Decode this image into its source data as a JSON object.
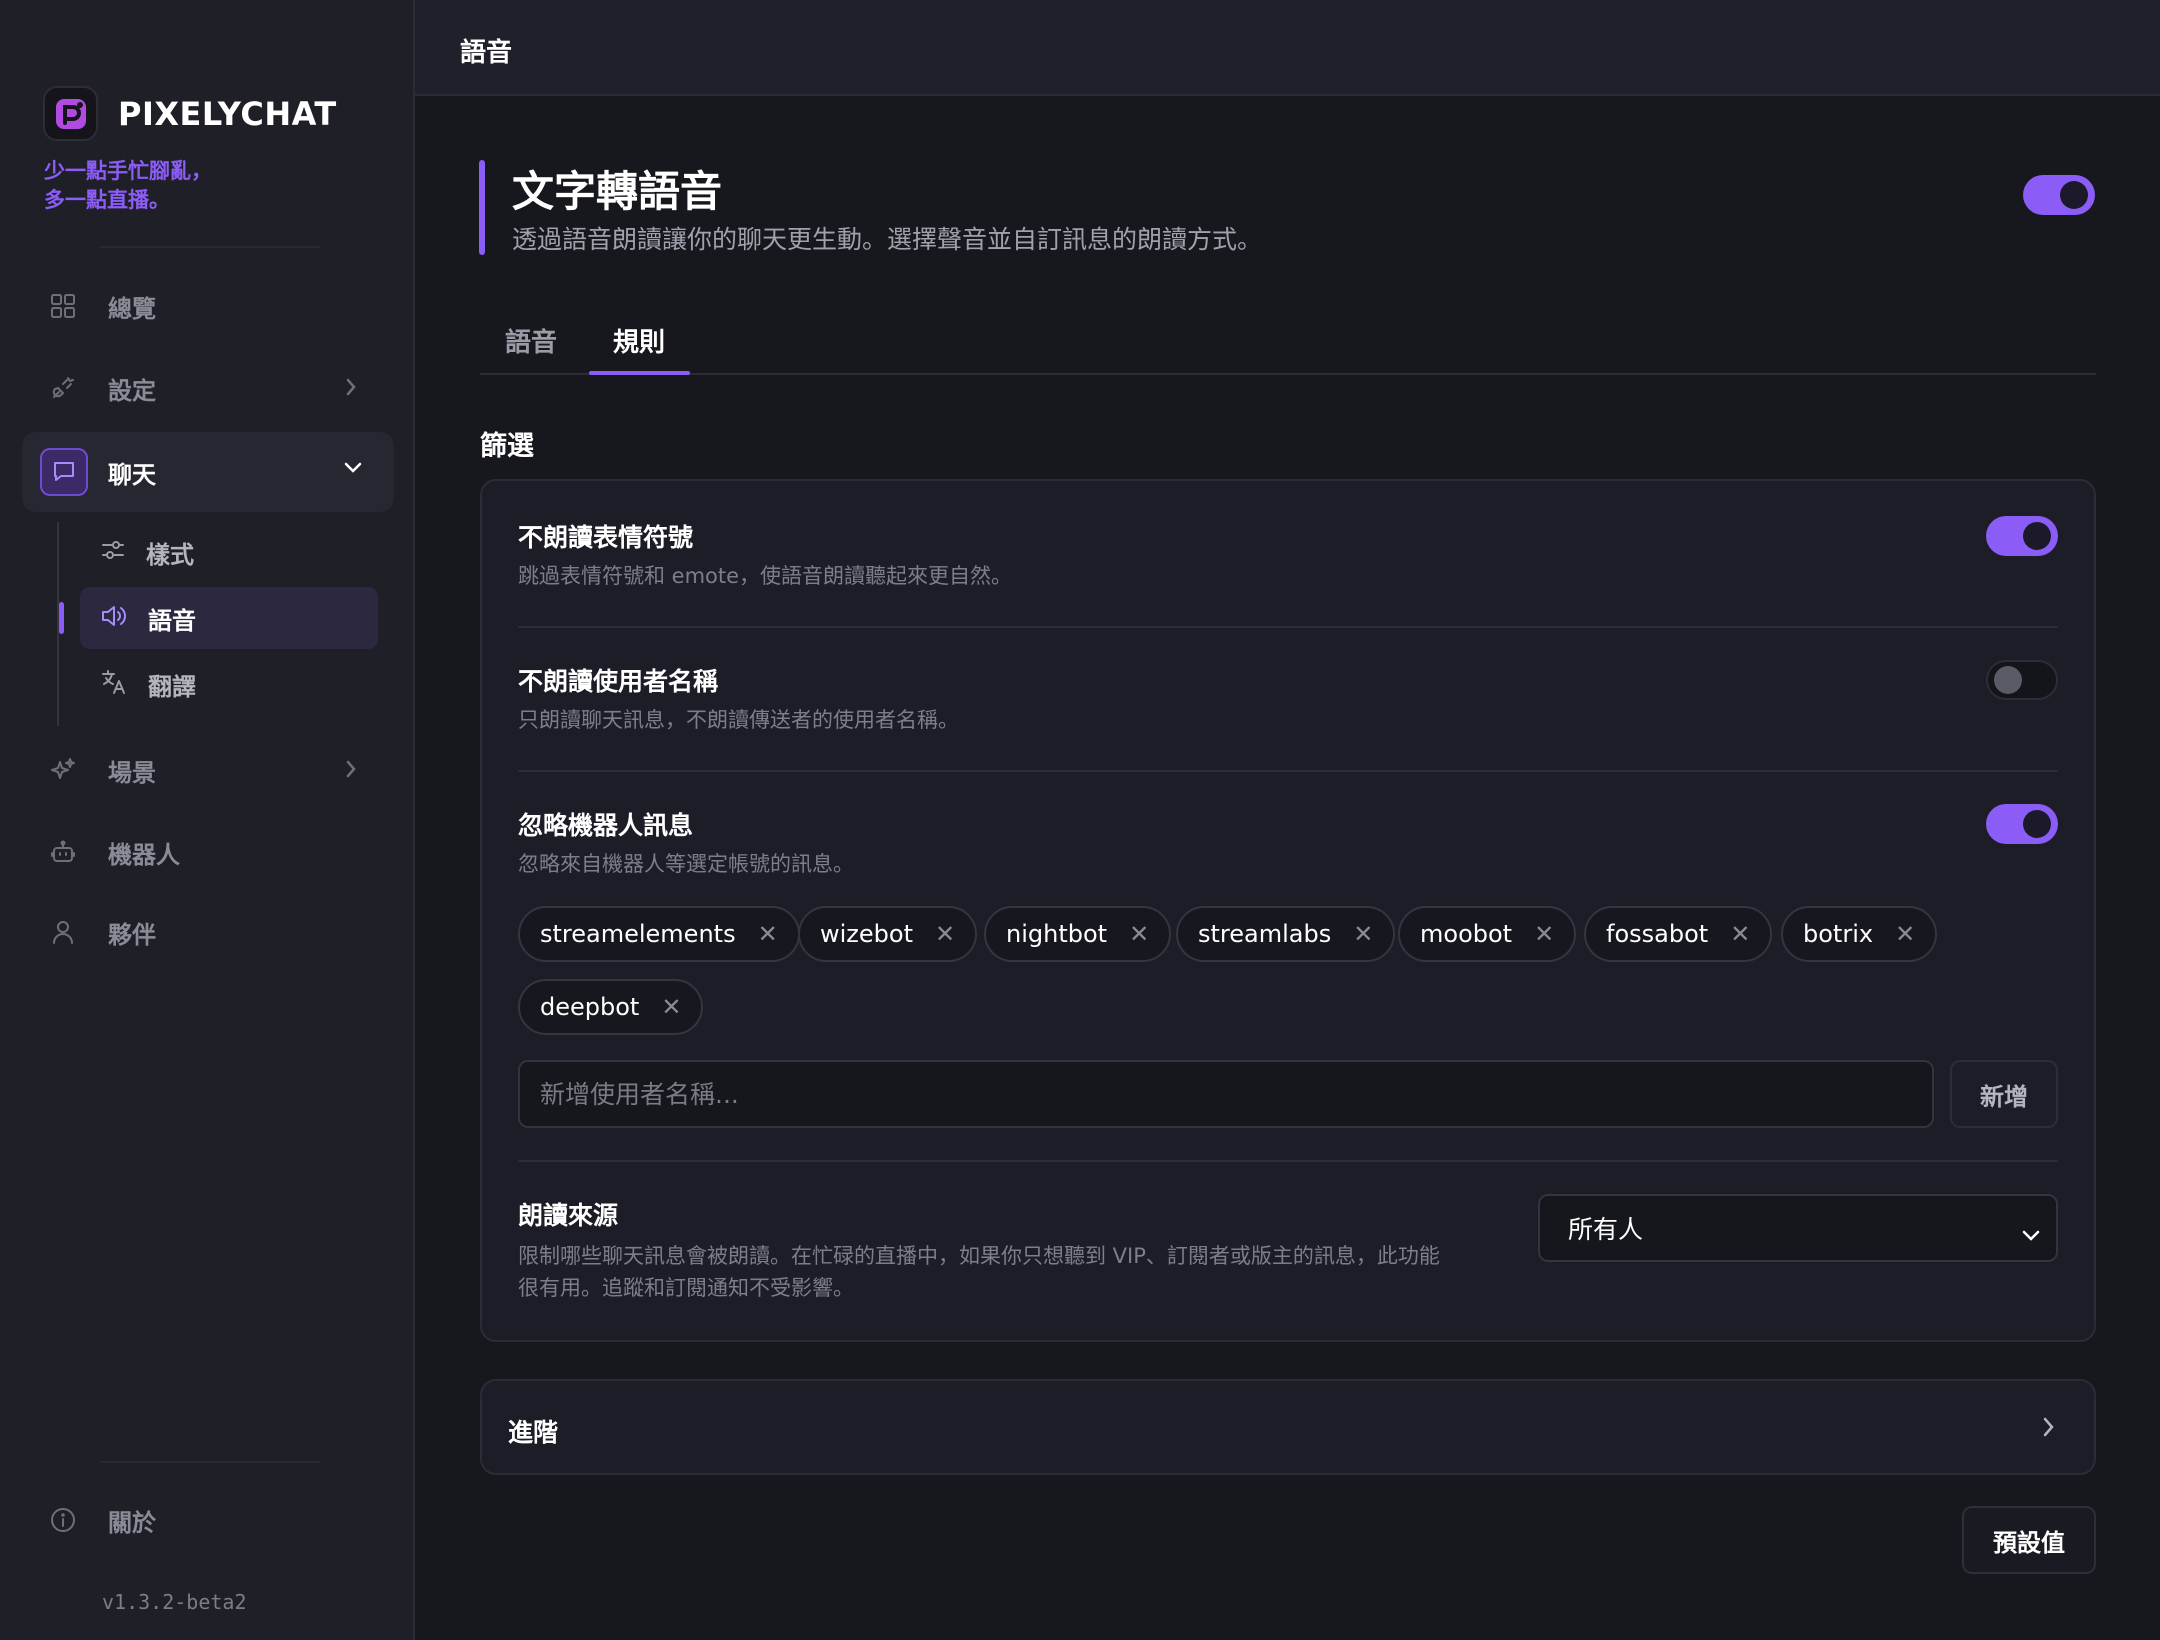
{
  "brand": {
    "name": "PIXELYCHAT",
    "tagline_1": "少一點手忙腳亂，",
    "tagline_2": "多一點直播。"
  },
  "sidebar": {
    "overview": "總覽",
    "settings": "設定",
    "chat": "聊天",
    "chat_sub": {
      "style": "樣式",
      "voice": "語音",
      "translate": "翻譯"
    },
    "scenes": "場景",
    "bots": "機器人",
    "partners": "夥伴",
    "about": "關於",
    "version": "v1.3.2-beta2"
  },
  "header": {
    "title": "語音"
  },
  "hero": {
    "title": "文字轉語音",
    "subtitle": "透過語音朗讀讓你的聊天更生動。選擇聲音並自訂訊息的朗讀方式。",
    "enabled": true
  },
  "tabs": [
    {
      "label": "語音",
      "active": false
    },
    {
      "label": "規則",
      "active": true
    }
  ],
  "filters": {
    "section_title": "篩選",
    "skip_emotes": {
      "title": "不朗讀表情符號",
      "desc": "跳過表情符號和 emote，使語音朗讀聽起來更自然。",
      "enabled": true
    },
    "skip_usernames": {
      "title": "不朗讀使用者名稱",
      "desc": "只朗讀聊天訊息，不朗讀傳送者的使用者名稱。",
      "enabled": false
    },
    "ignore_bots": {
      "title": "忽略機器人訊息",
      "desc": "忽略來自機器人等選定帳號的訊息。",
      "enabled": true,
      "bots": [
        "streamelements",
        "wizebot",
        "nightbot",
        "streamlabs",
        "moobot",
        "fossabot",
        "botrix",
        "deepbot"
      ],
      "remove_glyph": "✕",
      "add_placeholder": "新增使用者名稱...",
      "add_button": "新增"
    },
    "read_source": {
      "title": "朗讀來源",
      "desc_1": "限制哪些聊天訊息會被朗讀。在忙碌的直播中，如果你只想聽到 VIP、訂閱者或版主的訊息，此功能",
      "desc_2": "很有用。追蹤和訂閱通知不受影響。",
      "selected": "所有人"
    }
  },
  "advanced": {
    "label": "進階"
  },
  "footer": {
    "reset_button": "預設值"
  },
  "colors": {
    "accent": "#8b5cf6",
    "background": "#17181d",
    "sidebar": "#1e1f27",
    "card": "#1c1d26"
  }
}
